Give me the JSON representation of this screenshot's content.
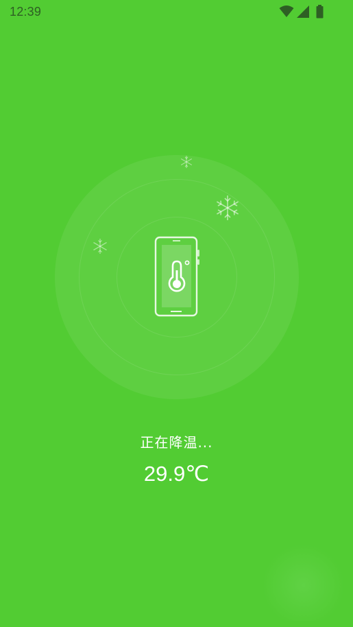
{
  "status_bar": {
    "time": "12:39",
    "icons": [
      "wifi-icon",
      "cellular-signal-icon",
      "battery-icon"
    ]
  },
  "cooling": {
    "status_text": "正在降温...",
    "temperature": "29.9℃"
  },
  "colors": {
    "background": "#52cc33",
    "status_bar_text": "#2e5f24",
    "foreground": "#ffffff"
  }
}
